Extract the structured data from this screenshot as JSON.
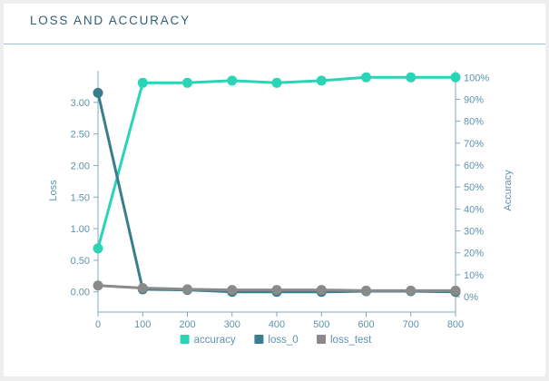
{
  "card": {
    "title": "LOSS AND ACCURACY"
  },
  "chart_data": {
    "type": "line",
    "x": [
      0,
      100,
      200,
      300,
      400,
      500,
      600,
      700,
      800
    ],
    "x_ticks": [
      "0",
      "100",
      "200",
      "300",
      "400",
      "500",
      "600",
      "700",
      "800"
    ],
    "xlim": [
      0,
      800
    ],
    "y_left": {
      "label": "Loss",
      "lim": [
        -0.32,
        3.5
      ],
      "ticks": [
        0.0,
        0.5,
        1.0,
        1.5,
        2.0,
        2.5,
        3.0
      ],
      "tick_labels": [
        "0.00",
        "0.50",
        "1.00",
        "1.50",
        "2.00",
        "2.50",
        "3.00"
      ]
    },
    "y_right": {
      "label": "Accuracy",
      "lim": [
        -0.07,
        1.03
      ],
      "ticks": [
        0,
        0.1,
        0.2,
        0.3,
        0.4,
        0.5,
        0.6,
        0.7,
        0.8,
        0.9,
        1.0
      ],
      "tick_labels": [
        "0%",
        "10%",
        "20%",
        "30%",
        "40%",
        "50%",
        "60%",
        "70%",
        "80%",
        "90%",
        "100%"
      ]
    },
    "series": [
      {
        "name": "accuracy",
        "axis": "right",
        "color": "#2ad4b6",
        "values": [
          0.22,
          0.975,
          0.975,
          0.985,
          0.975,
          0.985,
          1.0,
          1.0,
          1.0
        ]
      },
      {
        "name": "loss_0",
        "axis": "left",
        "color": "#3a7d8c",
        "values": [
          3.15,
          0.04,
          0.03,
          0.0,
          0.0,
          0.0,
          0.01,
          0.01,
          0.0
        ]
      },
      {
        "name": "loss_test",
        "axis": "left",
        "color": "#8a8a8a",
        "values": [
          0.1,
          0.06,
          0.04,
          0.03,
          0.03,
          0.03,
          0.02,
          0.02,
          0.02
        ]
      }
    ],
    "legend": {
      "position": "bottom"
    },
    "grid": false,
    "axis_color": "#7fa8be",
    "text_color": "#5d93ae"
  }
}
